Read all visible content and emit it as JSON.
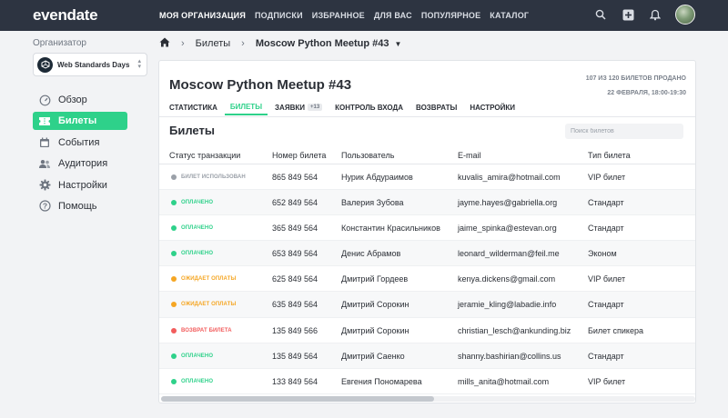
{
  "app": {
    "logo": "evendate",
    "nav": [
      "МОЯ ОРГАНИЗАЦИЯ",
      "ПОДПИСКИ",
      "ИЗБРАННОЕ",
      "ДЛЯ ВАС",
      "ПОПУЛЯРНОЕ",
      "КАТАЛОГ"
    ],
    "nav_active_index": 0,
    "icons": [
      "search-icon",
      "add-icon",
      "bell-icon",
      "avatar"
    ]
  },
  "sidebar": {
    "org_label": "Организатор",
    "org_name": "Web Standards Days",
    "items": [
      {
        "label": "Обзор",
        "icon": "gauge-icon",
        "active": false
      },
      {
        "label": "Билеты",
        "icon": "ticket-icon",
        "active": true
      },
      {
        "label": "События",
        "icon": "calendar-icon",
        "active": false
      },
      {
        "label": "Аудитория",
        "icon": "users-icon",
        "active": false
      },
      {
        "label": "Настройки",
        "icon": "gear-icon",
        "active": false
      },
      {
        "label": "Помощь",
        "icon": "help-icon",
        "active": false
      }
    ]
  },
  "breadcrumb": {
    "items": [
      "Билеты",
      "Moscow Python Meetup #43"
    ]
  },
  "event": {
    "title": "Moscow Python Meetup #43",
    "sold": "107 ИЗ 120 БИЛЕТОВ ПРОДАНО",
    "date": "22 ФЕВРАЛЯ, 18:00-19:30"
  },
  "tabs": [
    {
      "label": "СТАТИСТИКА",
      "active": false
    },
    {
      "label": "БИЛЕТЫ",
      "active": true
    },
    {
      "label": "ЗАЯВКИ",
      "count": "+13",
      "active": false
    },
    {
      "label": "КОНТРОЛЬ ВХОДА",
      "active": false
    },
    {
      "label": "ВОЗВРАТЫ",
      "active": false
    },
    {
      "label": "НАСТРОЙКИ",
      "active": false
    }
  ],
  "tickets": {
    "heading": "Билеты",
    "search_placeholder": "Поиск билетов",
    "columns": [
      "Статус транзакции",
      "Номер билета",
      "Пользователь",
      "E-mail",
      "Тип билета"
    ],
    "status_colors": {
      "БИЛЕТ ИСПОЛЬЗОВАН": "#9aa0a8",
      "ОПЛАЧЕНО": "#2ed18a",
      "ОЖИДАЕТ ОПЛАТЫ": "#f5a623",
      "ВОЗВРАТ БИЛЕТА": "#f25c5c"
    },
    "rows": [
      {
        "status": "БИЛЕТ ИСПОЛЬЗОВАН",
        "number": "865 849 564",
        "user": "Нурик Абдураимов",
        "email": "kuvalis_amira@hotmail.com",
        "type": "VIP билет"
      },
      {
        "status": "ОПЛАЧЕНО",
        "number": "652 849 564",
        "user": "Валерия Зубова",
        "email": "jayme.hayes@gabriella.org",
        "type": "Стандарт"
      },
      {
        "status": "ОПЛАЧЕНО",
        "number": "365 849 564",
        "user": "Константин Красильников",
        "email": "jaime_spinka@estevan.org",
        "type": "Стандарт"
      },
      {
        "status": "ОПЛАЧЕНО",
        "number": "653 849 564",
        "user": "Денис Абрамов",
        "email": "leonard_wilderman@feil.me",
        "type": "Эконом"
      },
      {
        "status": "ОЖИДАЕТ ОПЛАТЫ",
        "number": "625 849 564",
        "user": "Дмитрий Гордеев",
        "email": "kenya.dickens@gmail.com",
        "type": "VIP билет"
      },
      {
        "status": "ОЖИДАЕТ ОПЛАТЫ",
        "number": "635 849 564",
        "user": "Дмитрий Сорокин",
        "email": "jeramie_kling@labadie.info",
        "type": "Стандарт"
      },
      {
        "status": "ВОЗВРАТ БИЛЕТА",
        "number": "135 849 566",
        "user": "Дмитрий Сорокин",
        "email": "christian_lesch@ankunding.biz",
        "type": "Билет спикера"
      },
      {
        "status": "ОПЛАЧЕНО",
        "number": "135 849 564",
        "user": "Дмитрий Саенко",
        "email": "shanny.bashirian@collins.us",
        "type": "Стандарт"
      },
      {
        "status": "ОПЛАЧЕНО",
        "number": "133 849 564",
        "user": "Евгения Пономарева",
        "email": "mills_anita@hotmail.com",
        "type": "VIP билет"
      }
    ]
  }
}
